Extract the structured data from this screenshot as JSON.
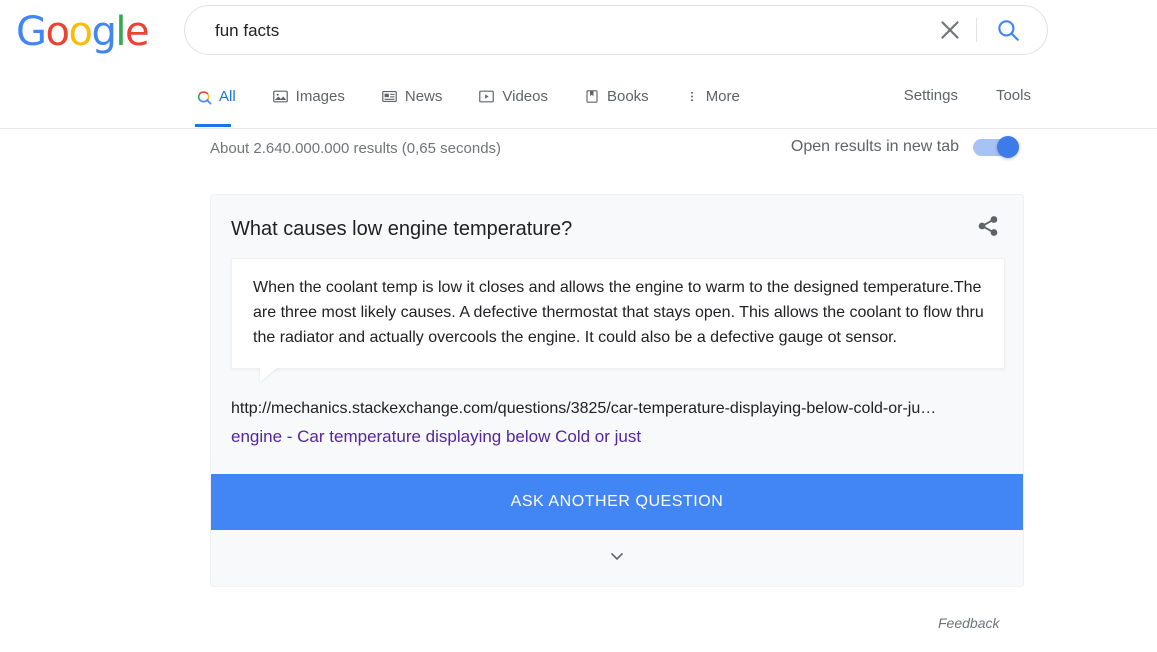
{
  "brand": {
    "name": "Google",
    "letters": [
      {
        "char": "G",
        "color": "#4285f4"
      },
      {
        "char": "o",
        "color": "#ea4335"
      },
      {
        "char": "o",
        "color": "#fbbc05"
      },
      {
        "char": "g",
        "color": "#4285f4"
      },
      {
        "char": "l",
        "color": "#34a853"
      },
      {
        "char": "e",
        "color": "#ea4335"
      }
    ]
  },
  "search": {
    "query": "fun facts",
    "placeholder": "Search",
    "clear_icon": "close-icon",
    "search_icon": "search-icon"
  },
  "nav": {
    "tabs": [
      {
        "label": "All",
        "icon": "search-icon",
        "active": true
      },
      {
        "label": "Images",
        "icon": "image-icon",
        "active": false
      },
      {
        "label": "News",
        "icon": "news-icon",
        "active": false
      },
      {
        "label": "Videos",
        "icon": "video-icon",
        "active": false
      },
      {
        "label": "Books",
        "icon": "book-icon",
        "active": false
      },
      {
        "label": "More",
        "icon": "more-vertical-icon",
        "active": false
      }
    ],
    "settings_label": "Settings",
    "tools_label": "Tools"
  },
  "results": {
    "stats": "About 2.640.000.000 results (0,65 seconds)",
    "new_tab_label": "Open results in new tab",
    "new_tab_enabled": true
  },
  "answer_card": {
    "question": "What causes low engine temperature?",
    "share_icon": "share-icon",
    "answer_text": "When the coolant temp is low it closes and allows the engine to warm to the designed temperature.The are three most likely causes. A defective thermostat that stays open. This allows the coolant to flow thru the radiator and actually overcools the engine. It could also be a defective gauge ot sensor.",
    "source_url": "http://mechanics.stackexchange.com/questions/3825/car-temperature-displaying-below-cold-or-ju…",
    "source_title": "engine - Car temperature displaying below Cold or just",
    "ask_button_label": "ASK ANOTHER QUESTION",
    "expand_icon": "chevron-down-icon"
  },
  "footer": {
    "feedback_label": "Feedback"
  },
  "colors": {
    "accent_blue": "#4285f4",
    "link_purple": "#5326a0",
    "tab_active": "#1a73e8",
    "muted_text": "#70757a",
    "card_bg": "#f8f9fa"
  }
}
